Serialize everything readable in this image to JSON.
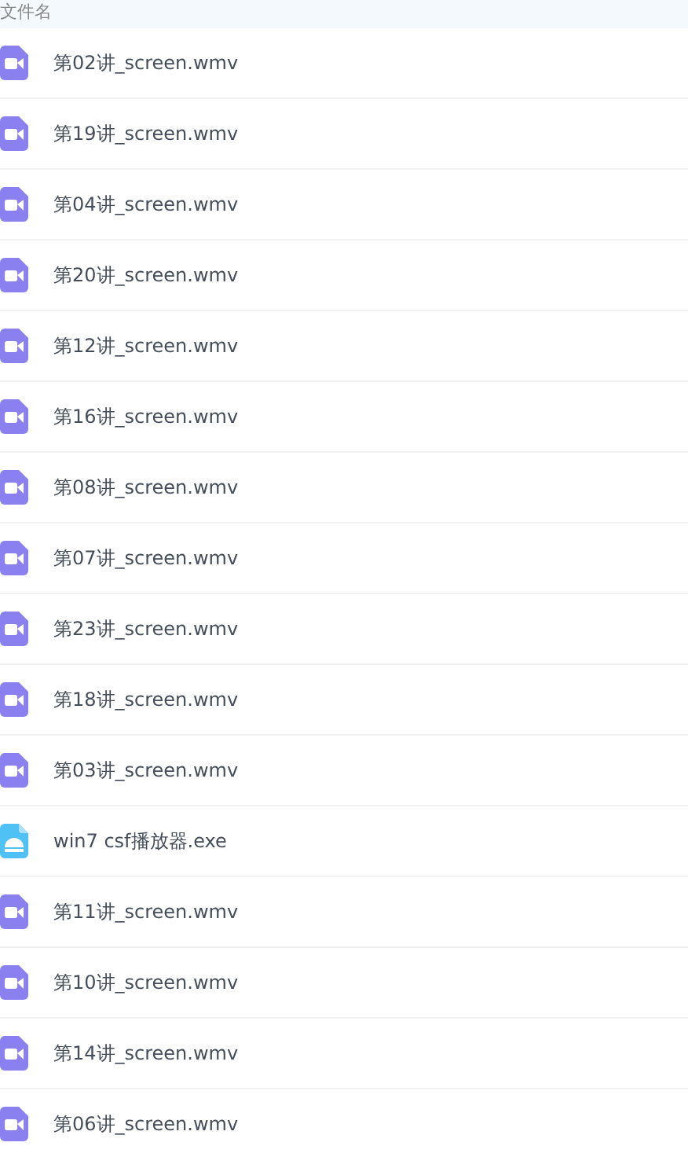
{
  "header": {
    "column_1": "文件名"
  },
  "files": [
    {
      "kind": "video",
      "name": "第02讲_screen.wmv"
    },
    {
      "kind": "video",
      "name": "第19讲_screen.wmv"
    },
    {
      "kind": "video",
      "name": "第04讲_screen.wmv"
    },
    {
      "kind": "video",
      "name": "第20讲_screen.wmv"
    },
    {
      "kind": "video",
      "name": "第12讲_screen.wmv"
    },
    {
      "kind": "video",
      "name": "第16讲_screen.wmv"
    },
    {
      "kind": "video",
      "name": "第08讲_screen.wmv"
    },
    {
      "kind": "video",
      "name": "第07讲_screen.wmv"
    },
    {
      "kind": "video",
      "name": "第23讲_screen.wmv"
    },
    {
      "kind": "video",
      "name": "第18讲_screen.wmv"
    },
    {
      "kind": "video",
      "name": "第03讲_screen.wmv"
    },
    {
      "kind": "exe",
      "name": "win7 csf播放器.exe"
    },
    {
      "kind": "video",
      "name": "第11讲_screen.wmv"
    },
    {
      "kind": "video",
      "name": "第10讲_screen.wmv"
    },
    {
      "kind": "video",
      "name": "第14讲_screen.wmv"
    },
    {
      "kind": "video",
      "name": "第06讲_screen.wmv"
    }
  ]
}
